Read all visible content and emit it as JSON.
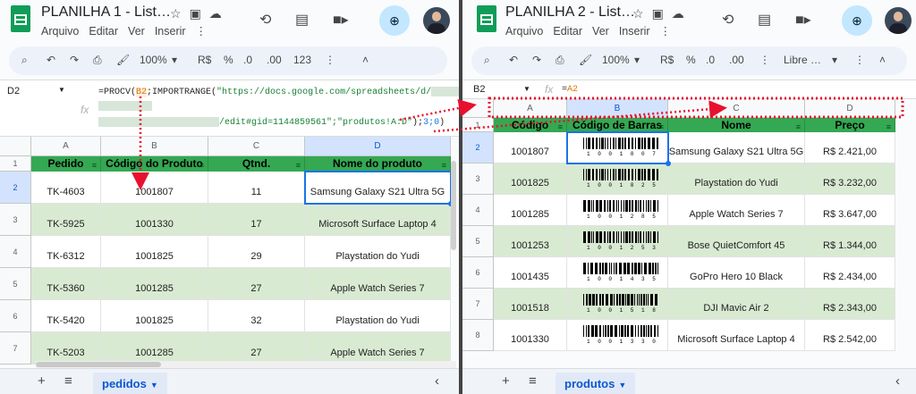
{
  "left": {
    "title": "PLANILHA 1 - List…",
    "menus": [
      "Arquivo",
      "Editar",
      "Ver",
      "Inserir"
    ],
    "zoom": "100%",
    "currency": "R$",
    "percent": "%",
    "dec_less": ".0",
    "dec_more": ".00",
    "numfmt": "123",
    "namebox": "D2",
    "formula_line1": "=PROCV(",
    "formula_ref": "B2",
    "formula_mid": ";IMPORTRANGE(",
    "formula_url": "\"https://docs.google.com/spreadsheets/d/",
    "formula_line3a": "/edit#gid=1144859561\"",
    "formula_line3b": ";\"produtos!A:D\"",
    "formula_line3c": ");",
    "formula_args": "3;0",
    "formula_close": ")",
    "columns": [
      "A",
      "B",
      "C",
      "D"
    ],
    "header_row": "1",
    "headers": [
      "Pedido",
      "Código do Produto",
      "Qtnd.",
      "Nome do produto"
    ],
    "rows": [
      {
        "num": "2",
        "cells": [
          "TK-4603",
          "1001807",
          "11",
          "Samsung Galaxy S21 Ultra 5G"
        ]
      },
      {
        "num": "3",
        "cells": [
          "TK-5925",
          "1001330",
          "17",
          "Microsoft Surface Laptop 4"
        ]
      },
      {
        "num": "4",
        "cells": [
          "TK-6312",
          "1001825",
          "29",
          "Playstation do Yudi"
        ]
      },
      {
        "num": "5",
        "cells": [
          "TK-5360",
          "1001285",
          "27",
          "Apple Watch Series 7"
        ]
      },
      {
        "num": "6",
        "cells": [
          "TK-5420",
          "1001825",
          "32",
          "Playstation do Yudi"
        ]
      },
      {
        "num": "7",
        "cells": [
          "TK-5203",
          "1001285",
          "27",
          "Apple Watch Series 7"
        ]
      }
    ],
    "sheet_tab": "pedidos"
  },
  "right": {
    "title": "PLANILHA 2 - List…",
    "menus": [
      "Arquivo",
      "Editar",
      "Ver",
      "Inserir"
    ],
    "zoom": "100%",
    "currency": "R$",
    "percent": "%",
    "dec_less": ".0",
    "dec_more": ".00",
    "font": "Libre …",
    "namebox": "B2",
    "formula_eq": "=",
    "formula_ref": "A2",
    "columns": [
      "A",
      "B",
      "C",
      "D"
    ],
    "header_row": "1",
    "headers": [
      "Código",
      "Código de Barras",
      "Nome",
      "Preço"
    ],
    "rows": [
      {
        "num": "2",
        "cells": [
          "1001807",
          "1 0 0 1 8 0 7",
          "Samsung Galaxy S21 Ultra 5G",
          "R$ 2.421,00"
        ]
      },
      {
        "num": "3",
        "cells": [
          "1001825",
          "1 0 0 1 8 2 5",
          "Playstation do Yudi",
          "R$ 3.232,00"
        ]
      },
      {
        "num": "4",
        "cells": [
          "1001285",
          "1 0 0 1 2 8 5",
          "Apple Watch Series 7",
          "R$ 3.647,00"
        ]
      },
      {
        "num": "5",
        "cells": [
          "1001253",
          "1 0 0 1 2 5 3",
          "Bose QuietComfort 45",
          "R$ 1.344,00"
        ]
      },
      {
        "num": "6",
        "cells": [
          "1001435",
          "1 0 0 1 4 3 5",
          "GoPro Hero 10 Black",
          "R$ 2.434,00"
        ]
      },
      {
        "num": "7",
        "cells": [
          "1001518",
          "1 0 0 1 5 1 8",
          "DJI Mavic Air 2",
          "R$ 2.343,00"
        ]
      },
      {
        "num": "8",
        "cells": [
          "1001330",
          "1 0 0 1 3 3 0",
          "Microsoft Surface Laptop 4",
          "R$ 2.542,00"
        ]
      }
    ],
    "sheet_tab": "produtos"
  },
  "colors": {
    "header_green": "#34a853",
    "band_green": "#d9ead3",
    "selection_blue": "#1a73e8",
    "annotation_red": "#e8112d"
  }
}
